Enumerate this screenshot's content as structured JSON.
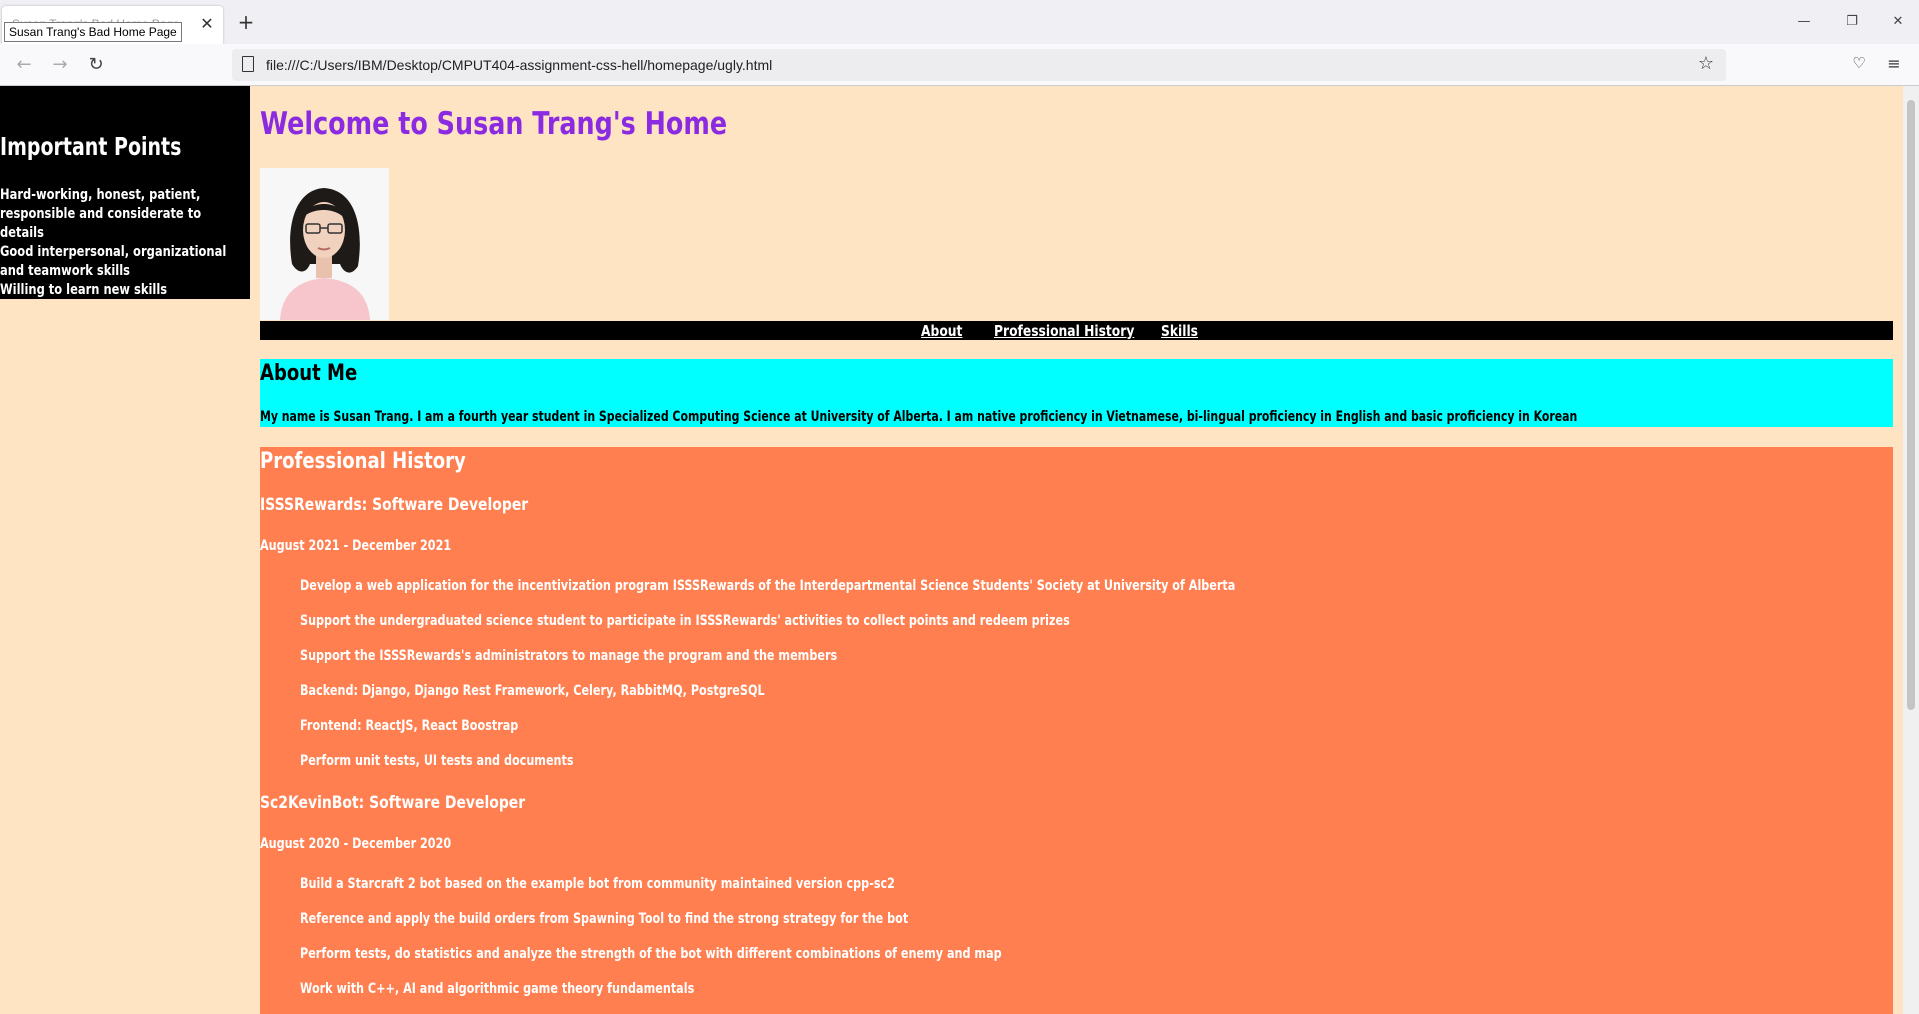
{
  "browser": {
    "tab_title": "Susan Trang's Bad Home Page",
    "tooltip": "Susan Trang's Bad Home Page",
    "url": "file:///C:/Users/IBM/Desktop/CMPUT404-assignment-css-hell/homepage/ugly.html"
  },
  "sidebar": {
    "title": "Important Points",
    "lines": [
      "Hard-working, honest, patient,",
      "responsible and considerate to",
      "details",
      "Good interpersonal, organizational",
      "and teamwork skills",
      "Willing to learn new skills"
    ]
  },
  "header": {
    "title": "Welcome to Susan Trang's Home"
  },
  "nav": {
    "about": "About",
    "history": "Professional History",
    "skills": "Skills"
  },
  "about": {
    "title": "About Me",
    "text": "My name is Susan Trang. I am a fourth year student in Specialized Computing Science at University of Alberta. I am native proficiency in Vietnamese, bi-lingual proficiency in English and basic proficiency in Korean"
  },
  "history": {
    "title": "Professional History",
    "jobs": [
      {
        "title": "ISSSRewards: Software Developer",
        "dates": "August 2021 - December 2021",
        "items": [
          "Develop a web application for the incentivization program ISSSRewards of the Interdepartmental Science Students' Society at University of Alberta",
          "Support the undergraduated science student to participate in ISSSRewards' activities to collect points and redeem prizes",
          "Support the ISSSRewards's administrators to manage the program and the members",
          "Backend: Django, Django Rest Framework, Celery, RabbitMQ, PostgreSQL",
          "Frontend: ReactJS, React Boostrap",
          "Perform unit tests, UI tests and documents"
        ]
      },
      {
        "title": "Sc2KevinBot: Software Developer",
        "dates": "August 2020 - December 2020",
        "items": [
          "Build a Starcraft 2 bot based on the example bot from community maintained version cpp-sc2",
          "Reference and apply the build orders from Spawning Tool to find the strong strategy for the bot",
          "Perform tests, do statistics and analyze the strength of the bot with different combinations of enemy and map",
          "Work with C++, AI and algorithmic game theory fundamentals"
        ]
      }
    ]
  },
  "colors": {
    "page_bg": "#ffe4c4",
    "welcome": "#8a2be2",
    "about_bg": "#00ffff",
    "history_bg": "#ff7f50",
    "sidebar_bg": "#000000"
  }
}
